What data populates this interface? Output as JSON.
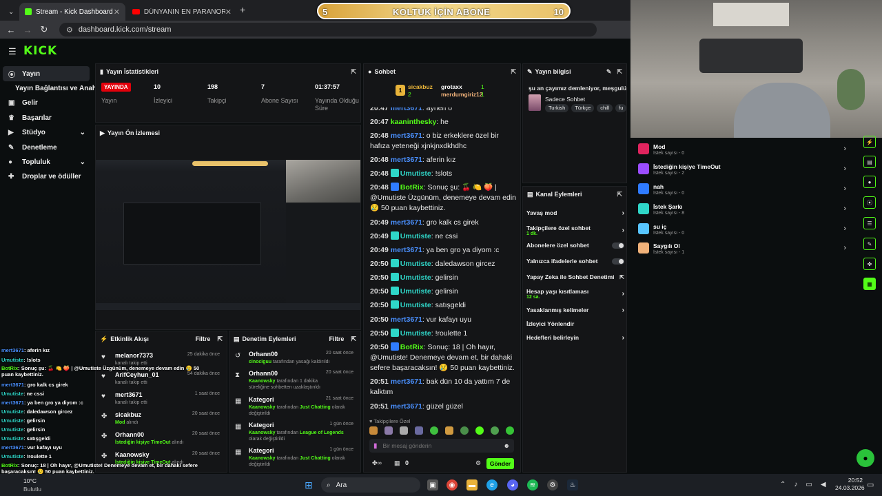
{
  "browser": {
    "tabs": [
      {
        "label": "Stream - Kick Dashboard",
        "active": true
      },
      {
        "label": "DÜNYANIN EN PARANORMAL",
        "active": false
      }
    ],
    "url": "dashboard.kick.com/stream"
  },
  "goal_banner": {
    "left": "5",
    "text": "KOLTUK İÇİN ABONE",
    "right": "10"
  },
  "kick": {
    "logo": "KICK"
  },
  "sidebar": {
    "items": [
      {
        "label": "Yayın",
        "icon": "broadcast-icon"
      },
      {
        "label": "Yayın Bağlantısı ve Anahtarı",
        "icon": ""
      },
      {
        "label": "Gelir",
        "icon": "wallet-icon"
      },
      {
        "label": "Başarılar",
        "icon": "trophy-icon"
      },
      {
        "label": "Stüdyo",
        "icon": "video-icon"
      },
      {
        "label": "Denetleme",
        "icon": "wrench-icon"
      },
      {
        "label": "Topluluk",
        "icon": "community-icon"
      },
      {
        "label": "Droplar ve ödüller",
        "icon": "gift-icon"
      }
    ]
  },
  "stats": {
    "title": "Yayın İstatistikleri",
    "live_label": "YAYINDA",
    "items": [
      {
        "value": "",
        "label": "Yayın"
      },
      {
        "value": "10",
        "label": "İzleyici"
      },
      {
        "value": "198",
        "label": "Takipçi"
      },
      {
        "value": "7",
        "label": "Abone Sayısı"
      },
      {
        "value": "01:37:57",
        "label": "Yayında Olduğu Süre"
      }
    ]
  },
  "preview": {
    "title": "Yayın Ön İzlemesi"
  },
  "activity": {
    "title": "Etkinlik Akışı",
    "filter": "Filtre",
    "rows": [
      {
        "name": "melanor7373",
        "sub": "kanalı takip etti",
        "time": "25 dakika önce",
        "icon": "heart-icon"
      },
      {
        "name": "ArifCeyhun_01",
        "sub": "kanalı takip etti",
        "time": "54 dakika önce",
        "icon": "heart-icon"
      },
      {
        "name": "mert3671",
        "sub": "kanalı takip etti",
        "time": "1 saat önce",
        "icon": "heart-icon"
      },
      {
        "name": "sicakbuz",
        "sub": "alındı",
        "sub_em": "Mod",
        "time": "20 saat önce",
        "icon": "reward-icon"
      },
      {
        "name": "Orhann00",
        "sub": "alındı",
        "sub_em": "İstediğin kişiye TimeOut",
        "time": "20 saat önce",
        "icon": "reward-icon"
      },
      {
        "name": "Kaanowsky",
        "sub": "alındı",
        "sub_em": "İstediğin kişiye TimeOut",
        "time": "20 saat önce",
        "icon": "reward-icon"
      }
    ]
  },
  "moderation": {
    "title": "Denetim Eylemleri",
    "filter": "Filtre",
    "rows": [
      {
        "name": "Orhann00",
        "em": "cinociguu",
        "sub": "tarafından yasağı kaldırıldı",
        "time": "20 saat önce",
        "icon": "undo-icon"
      },
      {
        "name": "Orhann00",
        "em": "Kaanowsky",
        "sub": "tarafından 1 dakika süreliğine sohbetten uzaklaştırıldı",
        "time": "20 saat önce",
        "icon": "timeout-icon"
      },
      {
        "name": "Kategori",
        "em": "Kaanowsky",
        "sub": "tarafından",
        "em2": "Just Chatting",
        "sub2": "olarak değiştirildi",
        "time": "21 saat önce",
        "icon": "category-icon"
      },
      {
        "name": "Kategori",
        "em": "Kaanowsky",
        "sub": "tarafından",
        "em2": "League of Legends",
        "sub2": "olarak değiştirildi",
        "time": "1 gün önce",
        "icon": "category-icon"
      },
      {
        "name": "Kategori",
        "em": "Kaanowsky",
        "sub": "tarafından",
        "em2": "Just Chatting",
        "sub2": "olarak değiştirildi",
        "time": "1 gün önce",
        "icon": "category-icon"
      }
    ]
  },
  "chat": {
    "title": "Sohbet",
    "top": {
      "first": "sicakbuz",
      "first_count": "1",
      "second": "grotaxx",
      "second_count": "1",
      "third": "merdumgiriz12",
      "third_count": "1",
      "rank": "1",
      "rank2": "2"
    },
    "messages": [
      {
        "time": "20:47",
        "user": "mert3671",
        "color": "blue",
        "text": "aynen o"
      },
      {
        "time": "20:47",
        "user": "kaaninthesky",
        "color": "green",
        "text": "he"
      },
      {
        "time": "20:48",
        "user": "mert3671",
        "color": "blue",
        "text": "o biz erkeklere özel bir hafıza yeteneği xjnkjnxdkhdhc"
      },
      {
        "time": "20:48",
        "user": "mert3671",
        "color": "blue",
        "text": "aferin kız"
      },
      {
        "time": "20:48",
        "user": "Umutiste",
        "color": "teal",
        "text": "!slots"
      },
      {
        "time": "20:48",
        "user": "BotRix",
        "color": "green",
        "text": "Sonuç şu: 🍒 🍋 🍑 | @Umutiste Üzgünüm, denemeye devam edin 😢 50 puan kaybettiniz."
      },
      {
        "time": "20:49",
        "user": "mert3671",
        "color": "blue",
        "text": "gro kalk cs girek"
      },
      {
        "time": "20:49",
        "user": "Umutiste",
        "color": "teal",
        "text": "ne cssi"
      },
      {
        "time": "20:49",
        "user": "mert3671",
        "color": "blue",
        "text": "ya ben gro ya diyom :c"
      },
      {
        "time": "20:50",
        "user": "Umutiste",
        "color": "teal",
        "text": "daledawson gircez"
      },
      {
        "time": "20:50",
        "user": "Umutiste",
        "color": "teal",
        "text": "gelirsin"
      },
      {
        "time": "20:50",
        "user": "Umutiste",
        "color": "teal",
        "text": "gelirsin"
      },
      {
        "time": "20:50",
        "user": "Umutiste",
        "color": "teal",
        "text": "satışgeldi"
      },
      {
        "time": "20:50",
        "user": "mert3671",
        "color": "blue",
        "text": "vur kafayı uyu"
      },
      {
        "time": "20:50",
        "user": "Umutiste",
        "color": "teal",
        "text": "!roulette 1"
      },
      {
        "time": "20:50",
        "user": "BotRix",
        "color": "green",
        "text": "Sonuç: 18 | Oh hayır, @Umutiste! Denemeye devam et, bir dahaki sefere başaracaksın! 😢 50 puan kaybettiniz."
      },
      {
        "time": "20:51",
        "user": "mert3671",
        "color": "blue",
        "text": "bak dün 10 da yattım 7 de kalktım"
      },
      {
        "time": "20:51",
        "user": "mert3671",
        "color": "blue",
        "text": "güzel güzel"
      }
    ],
    "followers_only": "Takipçilere Özel",
    "input_placeholder": "Bir mesaj gönderin",
    "points": "0",
    "send": "Gönder"
  },
  "stream_info": {
    "title": "Yayın bilgisi",
    "stream_title": "şu an çayımız demleniyor, meşgulüz",
    "category": "Sadece Sohbet",
    "tags": [
      "Turkish",
      "Türkçe",
      "chill",
      "fu"
    ]
  },
  "channel_actions": {
    "title": "Kanal Eylemleri",
    "items": [
      {
        "label": "Yavaş mod",
        "sub": "",
        "control": "chevron"
      },
      {
        "label": "Takipçilere özel sohbet",
        "sub": "1 dk.",
        "control": "chevron"
      },
      {
        "label": "Abonelere özel sohbet",
        "sub": "",
        "control": "toggle"
      },
      {
        "label": "Yalnızca ifadelerle sohbet",
        "sub": "",
        "control": "toggle"
      },
      {
        "label": "Yapay Zeka ile Sohbet Denetimi",
        "sub": "",
        "control": "external"
      },
      {
        "label": "Hesap yaşı kısıtlaması",
        "sub": "12 sa.",
        "control": "chevron"
      },
      {
        "label": "Yasaklanmış kelimeler",
        "sub": "",
        "control": "chevron"
      },
      {
        "label": "İzleyici Yönlendir",
        "sub": "",
        "control": "none"
      },
      {
        "label": "Hedefleri belirleyin",
        "sub": "",
        "control": "chevron"
      }
    ]
  },
  "rewards": {
    "items": [
      {
        "name": "Mod",
        "count": "İstek sayısı - 0",
        "color": "#e0245e"
      },
      {
        "name": "İstediğin kişiye TimeOut",
        "count": "İstek sayısı - 2",
        "color": "#9b4dff"
      },
      {
        "name": "nah",
        "count": "İstek sayısı - 0",
        "color": "#2f7bff"
      },
      {
        "name": "İstek Şarkı",
        "count": "İstek sayısı - 8",
        "color": "#2fd6c8"
      },
      {
        "name": "su iç",
        "count": "İstek sayısı - 0",
        "color": "#58c6ff"
      },
      {
        "name": "Saygılı Ol",
        "count": "İstek sayısı - 1",
        "color": "#f0b27a"
      }
    ]
  },
  "overlay_chat": [
    {
      "user": "mert3671",
      "text": ": aferin kız"
    },
    {
      "user": "Umutiste",
      "text": ": !slots"
    },
    {
      "user": "BotRix",
      "text": ": Sonuç şu: 🍒 🍋 🍑 | @Umutiste Üzgünüm, denemeye devam edin 😢 50 puan kaybettiniz."
    },
    {
      "user": "mert3671",
      "text": ": gro kalk cs girek"
    },
    {
      "user": "Umutiste",
      "text": ": ne cssi"
    },
    {
      "user": "mert3671",
      "text": ": ya ben gro ya diyom :c"
    },
    {
      "user": "Umutiste",
      "text": ": daledawson gircez"
    },
    {
      "user": "Umutiste",
      "text": ": gelirsin"
    },
    {
      "user": "Umutiste",
      "text": ": gelirsin"
    },
    {
      "user": "Umutiste",
      "text": ": satışgeldi"
    },
    {
      "user": "mert3671",
      "text": ": vur kafayı uyu"
    },
    {
      "user": "Umutiste",
      "text": ": !roulette 1"
    },
    {
      "user": "BotRix",
      "text": ": Sonuç: 18 | Oh hayır, @Umutiste! Denemeye devam et, bir dahaki sefere başaracaksın! 😢 50 puan kaybettiniz."
    },
    {
      "user": "mert3671",
      "text": ": bak dün 10 da yattım 7 de kalktım"
    },
    {
      "user": "mert3671",
      "text": ": güzel güzel"
    }
  ],
  "taskbar": {
    "search": "Ara",
    "weather_temp": "10°C",
    "weather_desc": "Bulutlu",
    "time": "20:52",
    "date": "24.03.2026"
  },
  "colors": {
    "accent": "#53fc18",
    "live": "#e3000b",
    "user_blue": "#4a90ff",
    "user_teal": "#2fd6c8"
  }
}
